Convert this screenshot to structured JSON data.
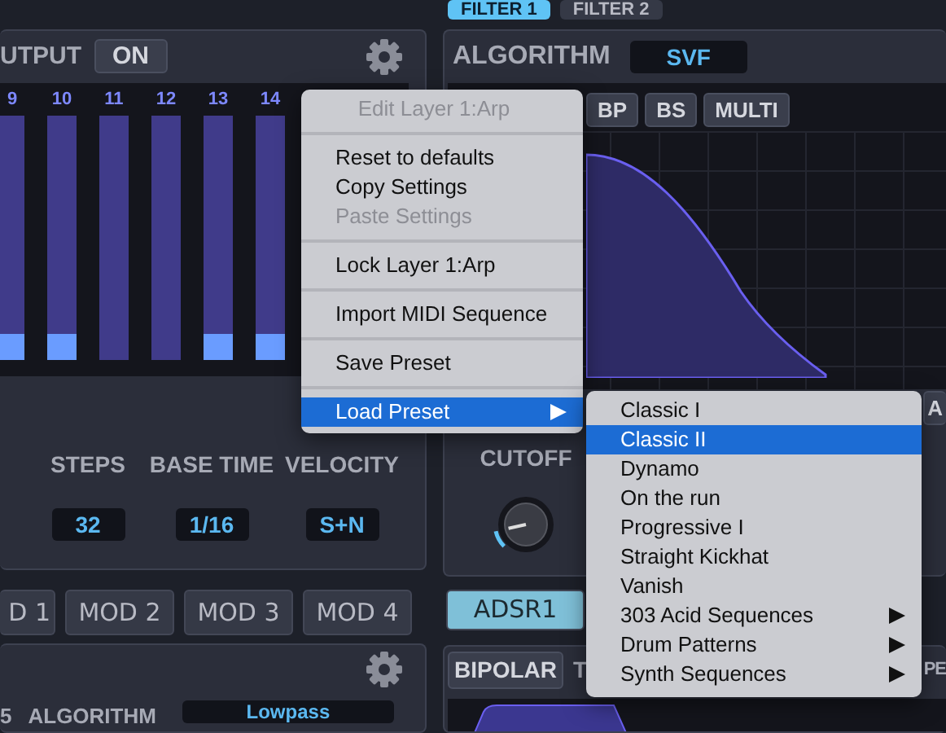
{
  "filter_tabs": [
    {
      "label": "FILTER 1",
      "selected": true
    },
    {
      "label": "FILTER 2",
      "selected": false
    }
  ],
  "arp_panel": {
    "output_label": "UTPUT",
    "output_button": "ON",
    "steps": [
      {
        "number": "9",
        "active": true
      },
      {
        "number": "10",
        "active": true
      },
      {
        "number": "11",
        "active": false
      },
      {
        "number": "12",
        "active": false
      },
      {
        "number": "13",
        "active": true
      },
      {
        "number": "14",
        "active": true
      }
    ],
    "params": [
      {
        "label": "STEPS",
        "value": "32"
      },
      {
        "label": "BASE TIME",
        "value": "1/16"
      },
      {
        "label": "VELOCITY",
        "value": "S+N"
      }
    ]
  },
  "mod_tabs": [
    {
      "label": "D 1"
    },
    {
      "label": "MOD 2"
    },
    {
      "label": "MOD 3"
    },
    {
      "label": "MOD 4"
    }
  ],
  "mod_panel": {
    "index": "5",
    "algorithm_label": "ALGORITHM",
    "algorithm_value": "Lowpass"
  },
  "filter_panel": {
    "algorithm_label": "ALGORITHM",
    "algorithm_value": "SVF",
    "types": [
      {
        "label": "BP"
      },
      {
        "label": "BS"
      },
      {
        "label": "MULTI"
      }
    ],
    "side_button": "A",
    "cutoff": {
      "label": "CUTOFF",
      "level": 0.12
    }
  },
  "env_tabs": [
    {
      "label": "ADSR1",
      "selected": true
    }
  ],
  "env_panel": {
    "bipolar": "BIPOLAR",
    "label_left": "T",
    "label_right": "PE"
  },
  "context_menu": [
    {
      "kind": "title",
      "label": "Edit Layer 1:Arp"
    },
    {
      "kind": "separator"
    },
    {
      "kind": "item",
      "label": "Reset to defaults",
      "disabled": false,
      "selected": false,
      "submenu": false
    },
    {
      "kind": "item",
      "label": "Copy Settings",
      "disabled": false,
      "selected": false,
      "submenu": false
    },
    {
      "kind": "item",
      "label": "Paste Settings",
      "disabled": true,
      "selected": false,
      "submenu": false
    },
    {
      "kind": "separator"
    },
    {
      "kind": "item",
      "label": "Lock Layer 1:Arp",
      "disabled": false,
      "selected": false,
      "submenu": false
    },
    {
      "kind": "separator"
    },
    {
      "kind": "item",
      "label": "Import MIDI Sequence",
      "disabled": false,
      "selected": false,
      "submenu": false
    },
    {
      "kind": "separator"
    },
    {
      "kind": "item",
      "label": "Save Preset",
      "disabled": false,
      "selected": false,
      "submenu": false
    },
    {
      "kind": "separator"
    },
    {
      "kind": "item",
      "label": "Load Preset",
      "disabled": false,
      "selected": true,
      "submenu": true
    }
  ],
  "submenu": [
    {
      "label": "Classic I",
      "selected": false,
      "submenu": false
    },
    {
      "label": "Classic II",
      "selected": true,
      "submenu": false
    },
    {
      "label": "Dynamo",
      "selected": false,
      "submenu": false
    },
    {
      "label": "On the run",
      "selected": false,
      "submenu": false
    },
    {
      "label": "Progressive I",
      "selected": false,
      "submenu": false
    },
    {
      "label": "Straight Kickhat",
      "selected": false,
      "submenu": false
    },
    {
      "label": "Vanish",
      "selected": false,
      "submenu": false
    },
    {
      "label": "303 Acid Sequences",
      "selected": false,
      "submenu": true
    },
    {
      "label": "Drum Patterns",
      "selected": false,
      "submenu": true
    },
    {
      "label": "Synth Sequences",
      "selected": false,
      "submenu": true
    }
  ]
}
